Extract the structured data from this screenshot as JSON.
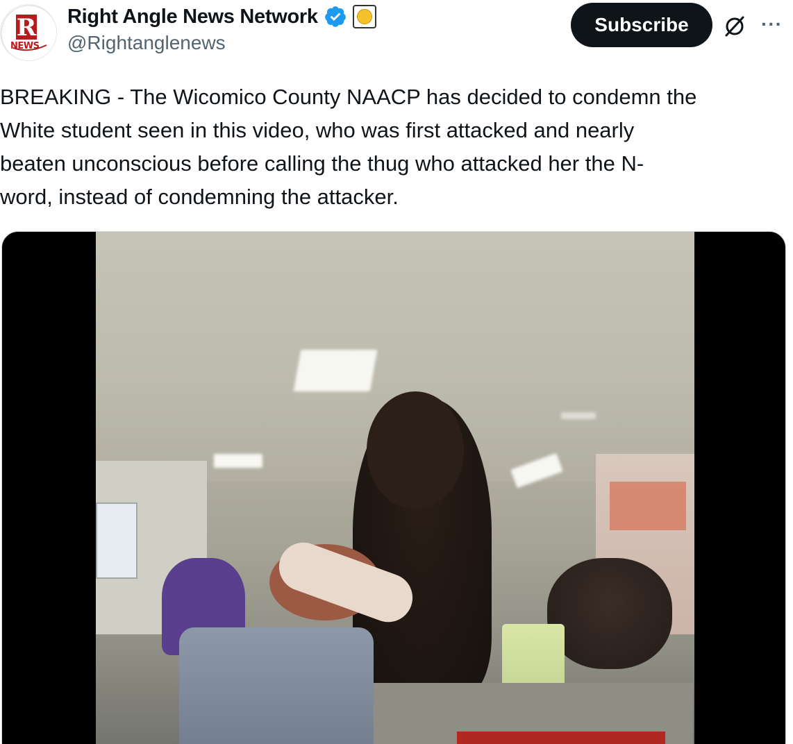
{
  "account": {
    "display_name": "Right Angle News Network",
    "handle": "@Rightanglenews",
    "avatar_text": "NEWS"
  },
  "actions": {
    "subscribe_label": "Subscribe",
    "more_label": "···"
  },
  "icons": {
    "verified": "verified-badge-icon",
    "affiliate": "affiliate-badge-icon",
    "grok": "grok-icon",
    "more": "more-icon"
  },
  "tweet": {
    "text": "BREAKING - The Wicomico County NAACP has decided to condemn the\nWhite student seen in this video, who was first attacked and nearly\nbeaten unconscious before calling the thug who attacked her the N-\nword, instead of condemning the attacker."
  },
  "colors": {
    "primary_text": "#0f1419",
    "secondary_text": "#536471",
    "verified_blue": "#1d9bf0",
    "button_bg": "#0f1419",
    "logo_red": "#b71c1c"
  }
}
